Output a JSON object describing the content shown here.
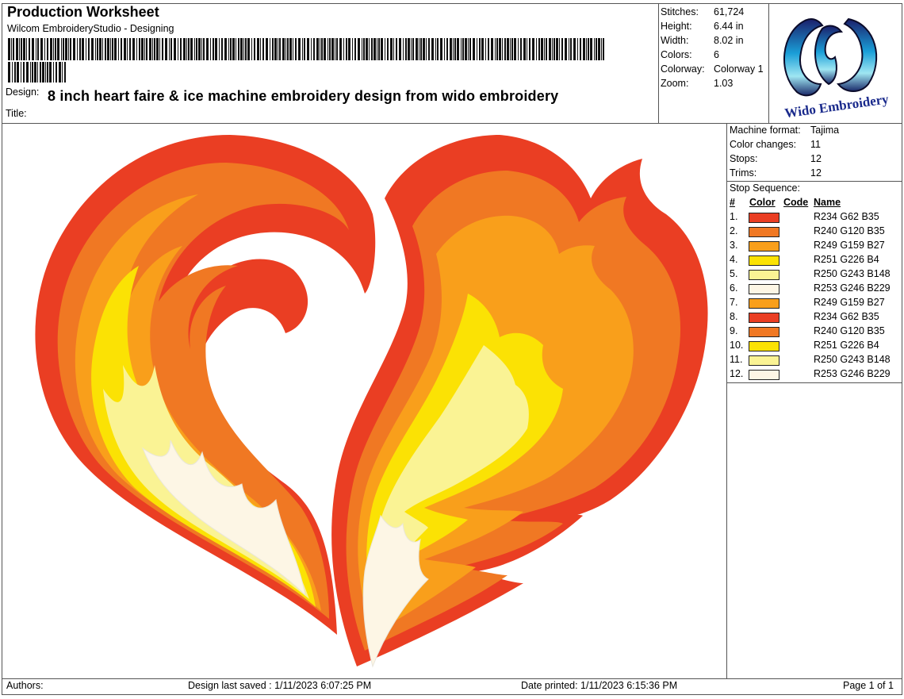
{
  "header": {
    "title": "Production Worksheet",
    "subtitle": "Wilcom EmbroideryStudio - Designing",
    "design_label": "Design:",
    "design_value": "8 inch heart faire & ice machine embroidery design from wido embroidery",
    "title_label": "Title:"
  },
  "stats": [
    {
      "label": "Stitches:",
      "value": "61,724"
    },
    {
      "label": "Height:",
      "value": "6.44 in"
    },
    {
      "label": "Width:",
      "value": "8.02 in"
    },
    {
      "label": "Colors:",
      "value": "6"
    },
    {
      "label": "Colorway:",
      "value": "Colorway 1"
    },
    {
      "label": "Zoom:",
      "value": "1.03"
    }
  ],
  "logo": {
    "text": "Wido Embroidery",
    "icon": "wido-embroidery-logo"
  },
  "machine": [
    {
      "label": "Machine format:",
      "value": "Tajima"
    },
    {
      "label": "Color changes:",
      "value": "11"
    },
    {
      "label": "Stops:",
      "value": "12"
    },
    {
      "label": "Trims:",
      "value": "12"
    }
  ],
  "stop_sequence": {
    "title": "Stop Sequence:",
    "headers": {
      "num": "#",
      "color": "Color",
      "code": "Code",
      "name": "Name"
    },
    "rows": [
      {
        "num": "1.",
        "color": "#EA3E23",
        "name": "R234 G62 B35"
      },
      {
        "num": "2.",
        "color": "#F07823",
        "name": "R240 G120 B35"
      },
      {
        "num": "3.",
        "color": "#F99F1B",
        "name": "R249 G159 B27"
      },
      {
        "num": "4.",
        "color": "#FBE204",
        "name": "R251 G226 B4"
      },
      {
        "num": "5.",
        "color": "#FAF394",
        "name": "R250 G243 B148"
      },
      {
        "num": "6.",
        "color": "#FDF6E5",
        "name": "R253 G246 B229"
      },
      {
        "num": "7.",
        "color": "#F99F1B",
        "name": "R249 G159 B27"
      },
      {
        "num": "8.",
        "color": "#EA3E23",
        "name": "R234 G62 B35"
      },
      {
        "num": "9.",
        "color": "#F07823",
        "name": "R240 G120 B35"
      },
      {
        "num": "10.",
        "color": "#FBE204",
        "name": "R251 G226 B4"
      },
      {
        "num": "11.",
        "color": "#FAF394",
        "name": "R250 G243 B148"
      },
      {
        "num": "12.",
        "color": "#FDF6E5",
        "name": "R253 G246 B229"
      }
    ]
  },
  "footer": {
    "authors": "Authors:",
    "saved": "Design last saved : 1/11/2023 6:07:25 PM",
    "printed": "Date printed: 1/11/2023 6:15:36 PM",
    "page": "Page 1 of 1"
  }
}
